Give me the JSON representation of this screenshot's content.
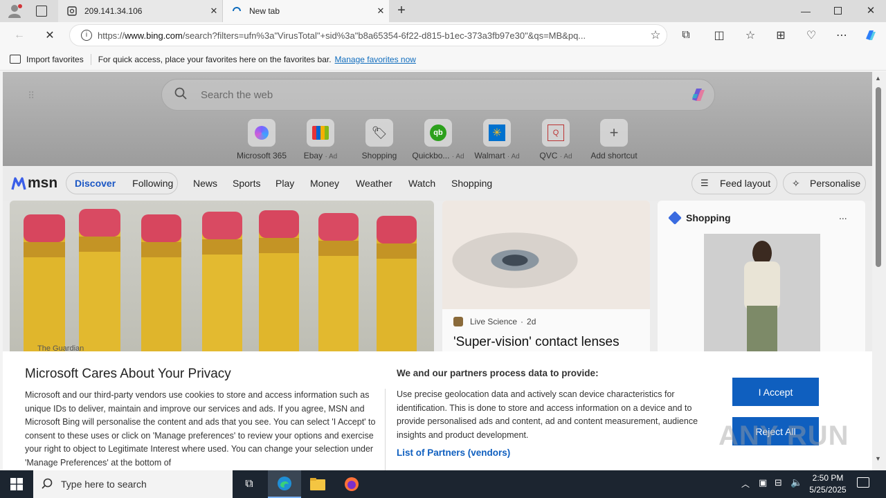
{
  "tabs": [
    {
      "title": "209.141.34.106",
      "active": false
    },
    {
      "title": "New tab",
      "active": true
    }
  ],
  "address_bar": {
    "url_prefix": "https://",
    "url_host": "www.bing.com",
    "url_rest": "/search?filters=ufn%3a\"VirusTotal\"+sid%3a\"b8a65354-6f22-d815-b1ec-373a3fb97e30\"&qs=MB&pq..."
  },
  "favorites_bar": {
    "import_label": "Import favorites",
    "hint": "For quick access, place your favorites here on the favorites bar.",
    "manage_link": "Manage favorites now"
  },
  "search": {
    "placeholder": "Search the web"
  },
  "shortcuts": [
    {
      "label": "Microsoft 365",
      "ad": ""
    },
    {
      "label": "Ebay",
      "ad": "· Ad"
    },
    {
      "label": "Shopping",
      "ad": ""
    },
    {
      "label": "Quickbo...",
      "ad": "· Ad"
    },
    {
      "label": "Walmart",
      "ad": "· Ad"
    },
    {
      "label": "QVC",
      "ad": "· Ad"
    },
    {
      "label": "Add shortcut",
      "ad": ""
    }
  ],
  "msn": {
    "logo": "msn",
    "tabs": [
      "Discover",
      "Following"
    ],
    "links": [
      "News",
      "Sports",
      "Play",
      "Money",
      "Weather",
      "Watch",
      "Shopping"
    ],
    "feed_layout": "Feed layout",
    "personalise": "Personalise"
  },
  "cards": {
    "main_source": "The Guardian",
    "story_source": "Live Science",
    "story_age": "2d",
    "story_title": "'Super-vision' contact lenses",
    "shopping_title": "Shopping",
    "shopping_more": "..."
  },
  "consent": {
    "title": "Microsoft Cares About Your Privacy",
    "body": "Microsoft and our third-party vendors use cookies to store and access information such as unique IDs to deliver, maintain and improve our services and ads. If you agree, MSN and Microsoft Bing will personalise the content and ads that you see. You can select 'I Accept' to consent to these uses or click on 'Manage preferences' to review your options and exercise your right to object to Legitimate Interest where used.  You can change your selection under 'Manage Preferences' at the bottom of",
    "partners_heading": "We and our partners process data to provide:",
    "partners_body": "Use precise geolocation data and actively scan device characteristics for identification. This is done to store and access information on a device and to provide personalised ads and content, ad and content measurement, audience insights and product development.",
    "partners_link": "List of Partners (vendors)",
    "accept": "I Accept",
    "reject": "Reject All"
  },
  "watermark": "ANY RUN",
  "taskbar": {
    "search_placeholder": "Type here to search",
    "time": "2:50 PM",
    "date": "5/25/2025"
  },
  "colors": {
    "accent": "#0f5fbf",
    "taskbar": "#1c2530",
    "link": "#0f6cbd"
  }
}
